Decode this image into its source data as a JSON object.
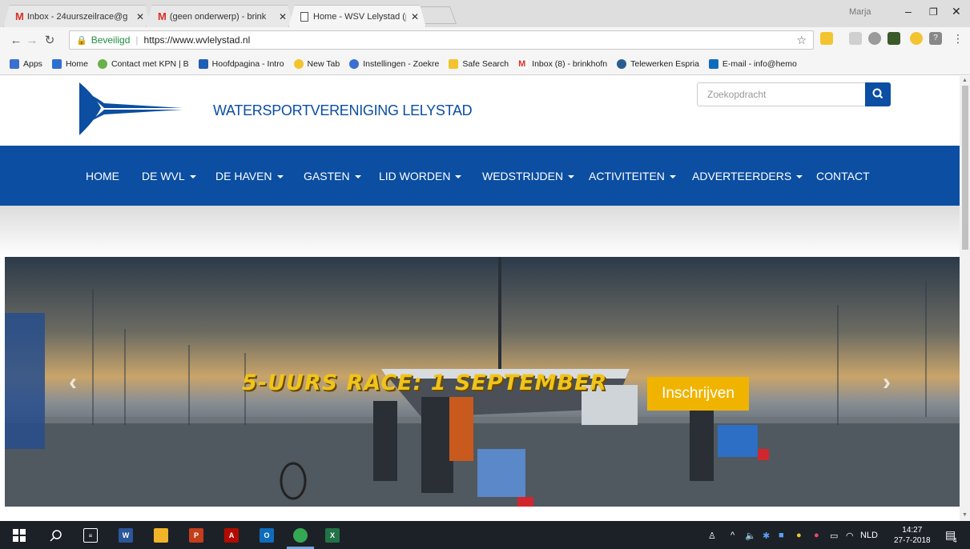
{
  "browser": {
    "tabs": [
      {
        "title": "Inbox - 24uurszeilrace@g",
        "icon": "gmail-icon"
      },
      {
        "title": "(geen onderwerp) - brink",
        "icon": "gmail-icon"
      },
      {
        "title": "Home - WSV Lelystad (pc",
        "icon": "page-icon"
      }
    ],
    "window_user": "Marja",
    "secure_label": "Beveiligd",
    "url": "https://www.wvlelystad.nl",
    "bookmarks": [
      {
        "label": "Apps"
      },
      {
        "label": "Home"
      },
      {
        "label": "Contact met KPN | B"
      },
      {
        "label": "Hoofdpagina - Intro"
      },
      {
        "label": "New Tab"
      },
      {
        "label": "Instellingen - Zoekre"
      },
      {
        "label": "Safe Search"
      },
      {
        "label": "Inbox (8) - brinkhofn"
      },
      {
        "label": "Telewerken Espria"
      },
      {
        "label": "E-mail - info@hemo"
      }
    ]
  },
  "site": {
    "title": "WATERSPORTVERENIGING LELYSTAD",
    "search_placeholder": "Zoekopdracht",
    "nav": [
      {
        "label": "HOME",
        "dropdown": false
      },
      {
        "label": "DE WVL",
        "dropdown": true
      },
      {
        "label": "DE HAVEN",
        "dropdown": true
      },
      {
        "label": "GASTEN",
        "dropdown": true
      },
      {
        "label": "LID WORDEN",
        "dropdown": true
      },
      {
        "label": "WEDSTRIJDEN",
        "dropdown": true
      },
      {
        "label": "ACTIVITEITEN",
        "dropdown": true
      },
      {
        "label": "ADVERTEERDERS",
        "dropdown": true
      },
      {
        "label": "CONTACT",
        "dropdown": false
      }
    ],
    "hero": {
      "caption": "5-UURS RACE: 1 SEPTEMBER",
      "button_label": "Inschrijven"
    },
    "colors": {
      "brand_blue": "#0b4ea2",
      "accent_yellow": "#f0b400"
    }
  },
  "taskbar": {
    "language": "NLD",
    "time": "14:27",
    "date": "27-7-2018",
    "notifications": "4"
  }
}
